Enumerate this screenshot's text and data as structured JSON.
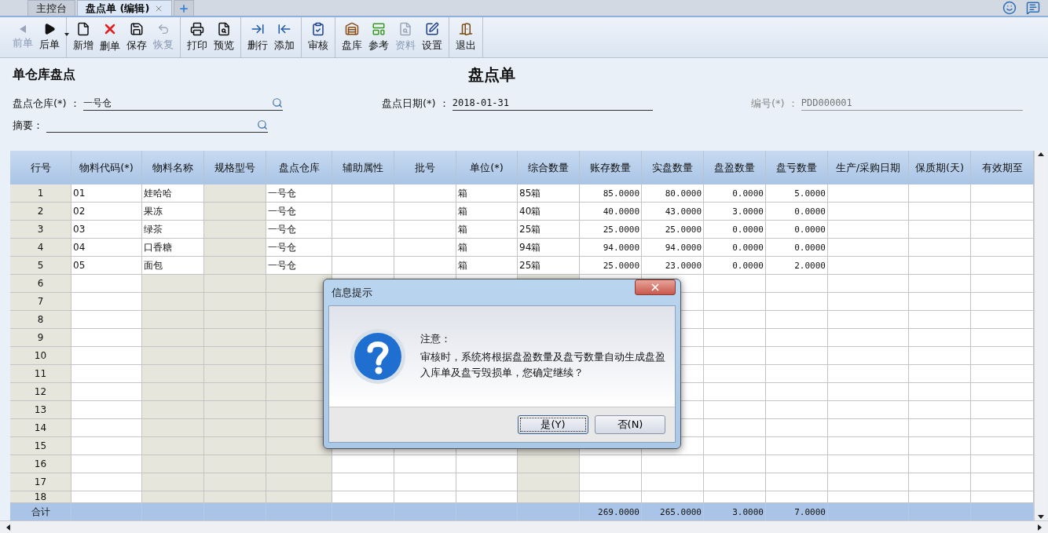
{
  "tabs": [
    {
      "label": "主控台",
      "selected": false,
      "closable": false
    },
    {
      "label": "盘点单 (编辑)",
      "selected": true,
      "closable": true
    }
  ],
  "toolbar": [
    [
      {
        "label": "前单",
        "kind": "prev",
        "disabled": true
      },
      {
        "label": "后单",
        "kind": "next",
        "disabled": false,
        "dropdown": true
      }
    ],
    [
      {
        "label": "新增",
        "kind": "new",
        "disabled": false
      },
      {
        "label": "删单",
        "kind": "delete",
        "disabled": false
      },
      {
        "label": "保存",
        "kind": "save",
        "disabled": false
      },
      {
        "label": "恢复",
        "kind": "undo",
        "disabled": true
      }
    ],
    [
      {
        "label": "打印",
        "kind": "print",
        "disabled": false
      },
      {
        "label": "预览",
        "kind": "preview",
        "disabled": false
      }
    ],
    [
      {
        "label": "删行",
        "kind": "delrow",
        "disabled": false
      },
      {
        "label": "添加",
        "kind": "addrow",
        "disabled": false
      }
    ],
    [
      {
        "label": "审核",
        "kind": "audit",
        "disabled": false
      }
    ],
    [
      {
        "label": "盘库",
        "kind": "stock",
        "disabled": false
      },
      {
        "label": "参考",
        "kind": "reference",
        "disabled": false
      },
      {
        "label": "资料",
        "kind": "docs",
        "disabled": true
      },
      {
        "label": "设置",
        "kind": "settings",
        "disabled": false
      }
    ],
    [
      {
        "label": "退出",
        "kind": "exit",
        "disabled": false
      }
    ]
  ],
  "form": {
    "subtitle": "单仓库盘点",
    "title": "盘点单",
    "rows": [
      [
        {
          "label": "盘点仓库(*) ：",
          "value": "一号仓",
          "lookup": true,
          "disabled": false
        },
        {
          "label": "盘点日期(*) ：",
          "value": "2018-01-31",
          "lookup": false,
          "disabled": false
        },
        {
          "label": "编号(*) ：",
          "value": "PDD000001",
          "lookup": false,
          "disabled": true
        }
      ],
      [
        {
          "label": "摘要：",
          "lookup": true,
          "disabled": false
        }
      ]
    ]
  },
  "grid": {
    "columns": [
      {
        "label": "行号",
        "kind": "rownum",
        "shaded": true
      },
      {
        "label": "物料代码(*)",
        "kind": "text",
        "shaded": false
      },
      {
        "label": "物料名称",
        "kind": "text",
        "shaded": true
      },
      {
        "label": "规格型号",
        "kind": "text",
        "shaded": true
      },
      {
        "label": "盘点仓库",
        "kind": "text",
        "shaded": true
      },
      {
        "label": "辅助属性",
        "kind": "text",
        "shaded": false
      },
      {
        "label": "批号",
        "kind": "text",
        "shaded": false
      },
      {
        "label": "单位(*)",
        "kind": "text",
        "shaded": false
      },
      {
        "label": "综合数量",
        "kind": "text",
        "shaded": true
      },
      {
        "label": "账存数量",
        "kind": "number",
        "shaded": false
      },
      {
        "label": "实盘数量",
        "kind": "number",
        "shaded": false
      },
      {
        "label": "盘盈数量",
        "kind": "number",
        "shaded": false
      },
      {
        "label": "盘亏数量",
        "kind": "number",
        "shaded": false
      },
      {
        "label": "生产/采购日期",
        "kind": "text",
        "shaded": false
      },
      {
        "label": "保质期(天)",
        "kind": "text",
        "shaded": false
      },
      {
        "label": "有效期至",
        "kind": "text",
        "shaded": false
      }
    ],
    "rows": [
      {
        "no": "1",
        "code": "01",
        "name": "娃哈哈",
        "warehouse": "一号仓",
        "unit": "箱",
        "combined": "85箱",
        "book": "85.0000",
        "actual": "80.0000",
        "gain": "0.0000",
        "loss": "5.0000"
      },
      {
        "no": "2",
        "code": "02",
        "name": "果冻",
        "warehouse": "一号仓",
        "unit": "箱",
        "combined": "40箱",
        "book": "40.0000",
        "actual": "43.0000",
        "gain": "3.0000",
        "loss": "0.0000"
      },
      {
        "no": "3",
        "code": "03",
        "name": "绿茶",
        "warehouse": "一号仓",
        "unit": "箱",
        "combined": "25箱",
        "book": "25.0000",
        "actual": "25.0000",
        "gain": "0.0000",
        "loss": "0.0000"
      },
      {
        "no": "4",
        "code": "04",
        "name": "口香糖",
        "warehouse": "一号仓",
        "unit": "箱",
        "combined": "94箱",
        "book": "94.0000",
        "actual": "94.0000",
        "gain": "0.0000",
        "loss": "0.0000"
      },
      {
        "no": "5",
        "code": "05",
        "name": "面包",
        "warehouse": "一号仓",
        "unit": "箱",
        "combined": "25箱",
        "book": "25.0000",
        "actual": "23.0000",
        "gain": "0.0000",
        "loss": "2.0000"
      },
      {
        "no": "6"
      },
      {
        "no": "7"
      },
      {
        "no": "8"
      },
      {
        "no": "9"
      },
      {
        "no": "10"
      },
      {
        "no": "11"
      },
      {
        "no": "12"
      },
      {
        "no": "13"
      },
      {
        "no": "14"
      },
      {
        "no": "15"
      },
      {
        "no": "16"
      },
      {
        "no": "17"
      },
      {
        "no": "18"
      }
    ],
    "total": {
      "no": "合计",
      "book": "269.0000",
      "actual": "265.0000",
      "gain": "3.0000",
      "loss": "7.0000"
    }
  },
  "dialog": {
    "title": "信息提示",
    "heading": "注意：",
    "message": "审核时，系统将根据盘盈数量及盘亏数量自动生成盘盈入库单及盘亏毁损单，您确定继续？",
    "buttons": [
      {
        "label": "是(Y)",
        "selected": true
      },
      {
        "label": "否(N)",
        "selected": false
      }
    ]
  }
}
